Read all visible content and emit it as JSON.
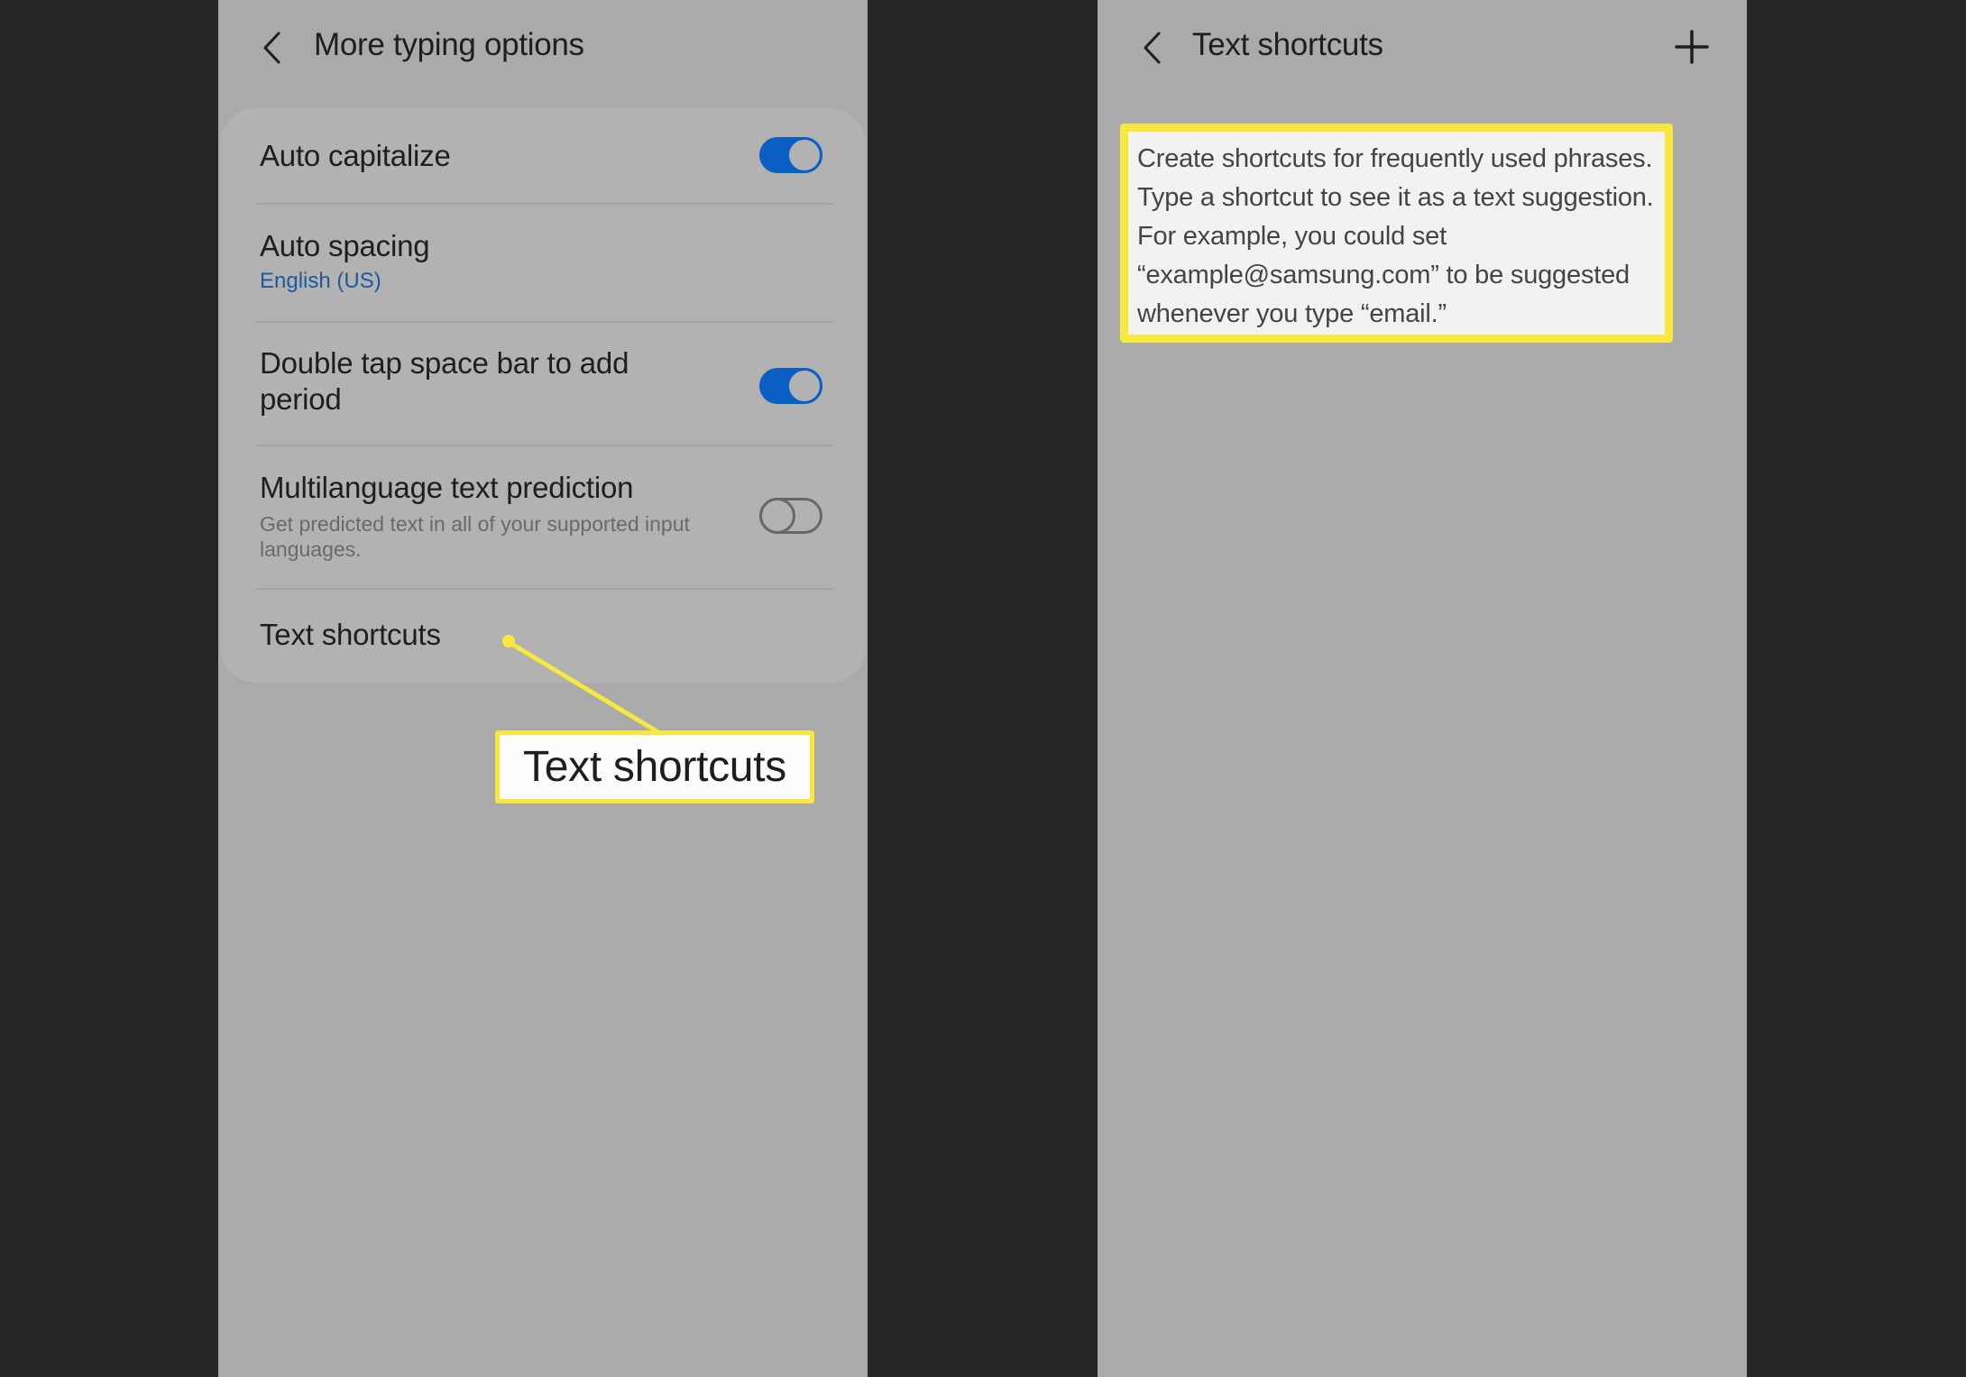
{
  "left_screen": {
    "header": {
      "back_icon": "chevron-left-icon",
      "title": "More typing options"
    },
    "settings": [
      {
        "title": "Auto capitalize",
        "toggle": true
      },
      {
        "title": "Auto spacing",
        "subtitle": "English (US)"
      },
      {
        "title": "Double tap space bar to add period",
        "toggle": true
      },
      {
        "title": "Multilanguage text prediction",
        "description": "Get predicted text in all of your supported input languages.",
        "toggle": false
      },
      {
        "title": "Text shortcuts"
      }
    ],
    "callout": {
      "label": "Text shortcuts",
      "color": "#f8e73c"
    }
  },
  "right_screen": {
    "header": {
      "back_icon": "chevron-left-icon",
      "title": "Text shortcuts",
      "add_icon": "plus-icon"
    },
    "info_text": "Create shortcuts for frequently used phrases. Type a shortcut to see it as a text suggestion. For example, you could set “example@samsung.com” to be suggested whenever you type “email.”",
    "highlight_color": "#f8e73c"
  },
  "colors": {
    "background": "#252525",
    "panel": "#aaaaaa",
    "card": "#b2b2b2",
    "accent": "#0a5fc4",
    "link": "#1b5aa0"
  }
}
